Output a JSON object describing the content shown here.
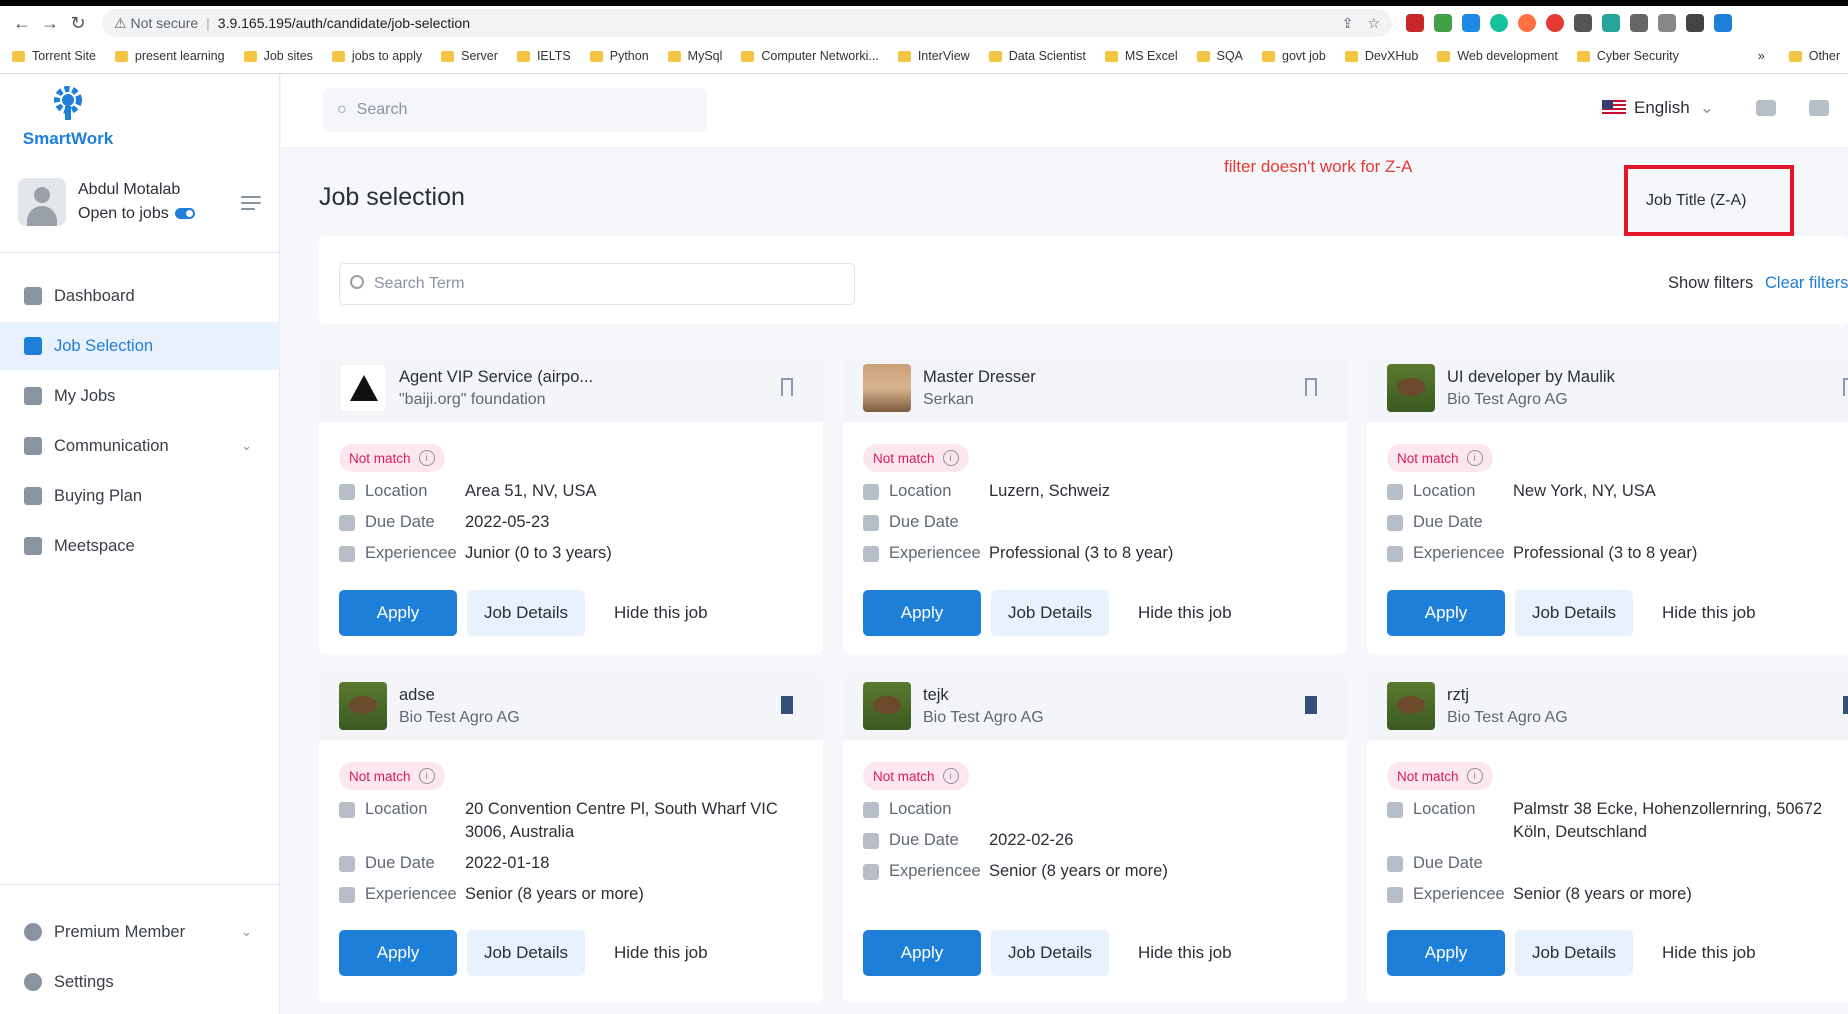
{
  "browser": {
    "security": "Not secure",
    "url": "3.9.165.195/auth/candidate/job-selection",
    "bookmarks": [
      "Torrent Site",
      "present learning",
      "Job sites",
      "jobs to apply",
      "Server",
      "IELTS",
      "Python",
      "MySql",
      "Computer Networki...",
      "InterView",
      "Data Scientist",
      "MS Excel",
      "SQA",
      "govt job",
      "DevXHub",
      "Web development",
      "Cyber Security"
    ],
    "more_bookmarks": "»",
    "other_bookmarks": "Other"
  },
  "app": {
    "logo_text": "SmartWork"
  },
  "profile": {
    "name": "Abdul Motalab",
    "status": "Open to jobs"
  },
  "nav": {
    "items": [
      {
        "label": "Dashboard",
        "icon": "dashboard-icon"
      },
      {
        "label": "Job Selection",
        "icon": "job-icon"
      },
      {
        "label": "My Jobs",
        "icon": "briefcase-icon"
      },
      {
        "label": "Communication",
        "icon": "chat-icon"
      },
      {
        "label": "Buying Plan",
        "icon": "plan-icon"
      },
      {
        "label": "Meetspace",
        "icon": "meet-icon"
      }
    ],
    "premium": "Premium Member",
    "settings": "Settings"
  },
  "header": {
    "search_placeholder": "Search",
    "language": "English"
  },
  "page": {
    "title": "Job selection",
    "annotation": "filter doesn't work for Z-A",
    "sort": "Job Title (Z-A)",
    "search_term_placeholder": "Search Term",
    "show_filters": "Show filters",
    "clear_filters": "Clear filters"
  },
  "labels": {
    "location": "Location",
    "due_date": "Due Date",
    "experience": "Experiencee",
    "apply": "Apply",
    "job_details": "Job Details",
    "hide": "Hide this job",
    "not_match": "Not match"
  },
  "jobs": [
    {
      "title": "Agent VIP Service (airpo...",
      "company": "\"baiji.org\" foundation",
      "location": "Area 51, NV, USA",
      "due": "2022-05-23",
      "experience": "Junior (0 to 3 years)"
    },
    {
      "title": "Master Dresser",
      "company": "Serkan",
      "location": "Luzern, Schweiz",
      "due": "",
      "experience": "Professional (3 to 8 year)"
    },
    {
      "title": "UI developer by Maulik",
      "company": "Bio Test Agro AG",
      "location": "New York, NY, USA",
      "due": "",
      "experience": "Professional (3 to 8 year)"
    },
    {
      "title": "adse",
      "company": "Bio Test Agro AG",
      "location": "20 Convention Centre Pl, South Wharf VIC 3006, Australia",
      "due": "2022-01-18",
      "experience": "Senior (8 years or more)"
    },
    {
      "title": "tejk",
      "company": "Bio Test Agro AG",
      "location": "",
      "due": "2022-02-26",
      "experience": "Senior (8 years or more)"
    },
    {
      "title": "rztj",
      "company": "Bio Test Agro AG",
      "location": "Palmstr 38 Ecke, Hohenzollernring, 50672 Köln, Deutschland",
      "due": "",
      "experience": "Senior (8 years or more)"
    }
  ]
}
